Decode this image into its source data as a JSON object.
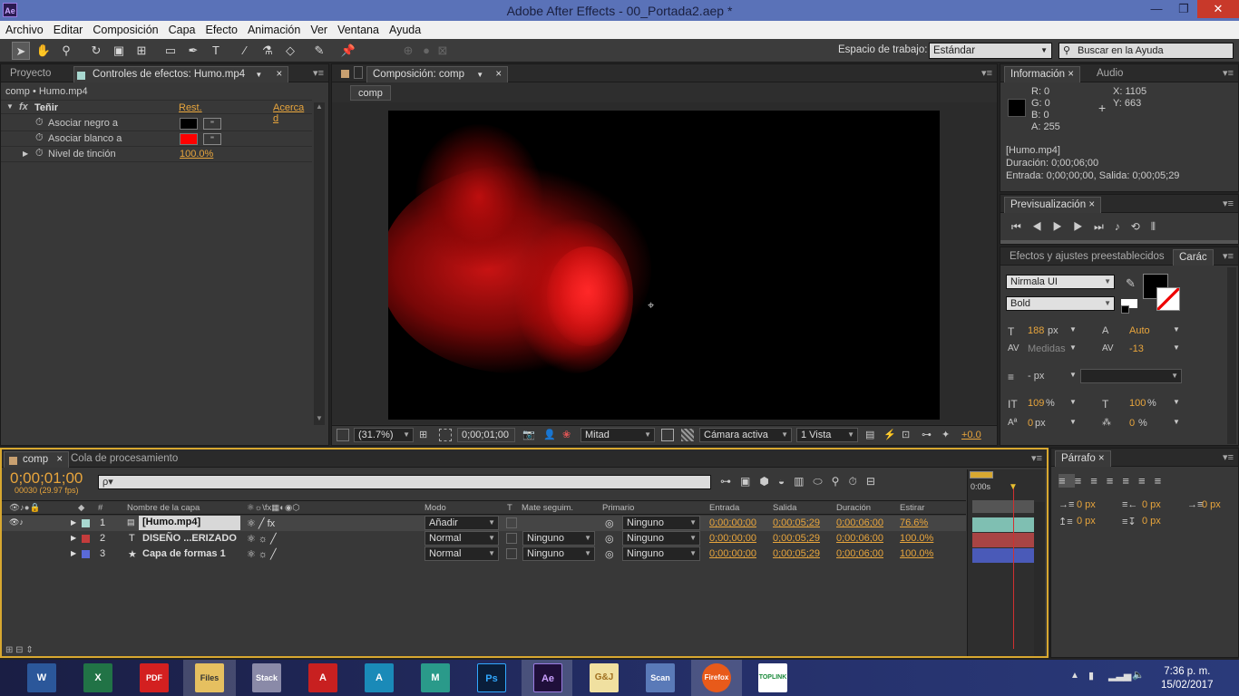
{
  "window": {
    "title": "Adobe After Effects - 00_Portada2.aep *",
    "app_badge": "Ae",
    "minimize": "—",
    "maximize": "❐",
    "close": "✕"
  },
  "menu": [
    "Archivo",
    "Editar",
    "Composición",
    "Capa",
    "Efecto",
    "Animación",
    "Ver",
    "Ventana",
    "Ayuda"
  ],
  "toolbar": {
    "workspace_label": "Espacio de trabajo:",
    "workspace_value": "Estándar",
    "search_placeholder": "Buscar en la Ayuda"
  },
  "left_panel": {
    "tab_project": "Proyecto",
    "tab_effects": "Controles de efectos: Humo.mp4",
    "breadcrumb": "comp • Humo.mp4",
    "effect_name": "Teñir",
    "reset": "Rest.",
    "about": "Acerca d",
    "props": [
      {
        "label": "Asociar negro a",
        "color": "#000000"
      },
      {
        "label": "Asociar blanco a",
        "color": "#ff0000"
      },
      {
        "label": "Nivel de tinción",
        "value": "100.0%"
      }
    ]
  },
  "comp_panel": {
    "tab": "Composición: comp",
    "comp_chip": "comp",
    "zoom": "(31.7%)",
    "timecode": "0;00;01;00",
    "resolution": "Mitad",
    "camera": "Cámara activa",
    "views": "1 Vista",
    "exposure": "+0.0"
  },
  "info_panel": {
    "tab_info": "Información",
    "tab_audio": "Audio",
    "r": "R:  0",
    "g": "G:  0",
    "b": "B:  0",
    "a": "A:  255",
    "x": "X:  1105",
    "y": "Y:  663",
    "file": "[Humo.mp4]",
    "duration": "Duración: 0;00;06;00",
    "in_out": "Entrada: 0;00;00;00, Salida: 0;00;05;29"
  },
  "preview_panel": {
    "tab": "Previsualización"
  },
  "char_panel": {
    "tab_effects": "Efectos y ajustes preestablecidos",
    "tab_char": "Carác",
    "font": "Nirmala UI",
    "style": "Bold",
    "size": "188",
    "size_unit": "px",
    "leading": "Auto",
    "kerning": "Medidas",
    "tracking": "-13",
    "stroke": "- px",
    "vscale": "109",
    "hscale": "100",
    "baseline": "0",
    "baseline_unit": "px",
    "tsume": "0",
    "pct": "%"
  },
  "timeline": {
    "tab_comp": "comp",
    "tab_render": "Cola de procesamiento",
    "timecode": "0;00;01;00",
    "fps": "00030 (29.97 fps)",
    "search_placeholder": "ρ▾",
    "ruler_start": "0:00s",
    "headers": {
      "num": "#",
      "name": "Nombre de la capa",
      "mode": "Modo",
      "t": "T",
      "track": "Mate seguim.",
      "parent": "Primario",
      "in": "Entrada",
      "out": "Salida",
      "dur": "Duración",
      "stretch": "Estirar"
    },
    "layers": [
      {
        "num": "1",
        "name": "[Humo.mp4]",
        "color": "#a8d8d0",
        "mode": "Añadir",
        "track": "",
        "parent": "Ninguno",
        "in": "0;00;00;00",
        "out": "0;00;05;29",
        "dur": "0;00;06;00",
        "stretch": "76.6%",
        "bar_color": "#7fbfb2"
      },
      {
        "num": "2",
        "name": "DISEÑO ...ERIZADO",
        "color": "#c43c3c",
        "mode": "Normal",
        "track": "Ninguno",
        "parent": "Ninguno",
        "in": "0;00;00;00",
        "out": "0;00;05;29",
        "dur": "0;00;06;00",
        "stretch": "100.0%",
        "bar_color": "#a84444"
      },
      {
        "num": "3",
        "name": "Capa de formas 1",
        "color": "#5a6ad8",
        "mode": "Normal",
        "track": "Ninguno",
        "parent": "Ninguno",
        "in": "0;00;00;00",
        "out": "0;00;05;29",
        "dur": "0;00;06;00",
        "stretch": "100.0%",
        "bar_color": "#4a5ab8"
      }
    ]
  },
  "paragraph_panel": {
    "tab": "Párrafo",
    "px1": "0 px",
    "px2": "0 px",
    "px3": "0 px",
    "px4": "0 px",
    "px5": "0 px"
  },
  "taskbar": {
    "apps": [
      "W",
      "X",
      "PDF",
      "Files",
      "Stack",
      "A",
      "A",
      "M",
      "Ps",
      "Ae",
      "G&J",
      "Scan",
      "Firefox",
      "TOPLINK"
    ],
    "time": "7:36 p. m.",
    "date": "15/02/2017"
  }
}
